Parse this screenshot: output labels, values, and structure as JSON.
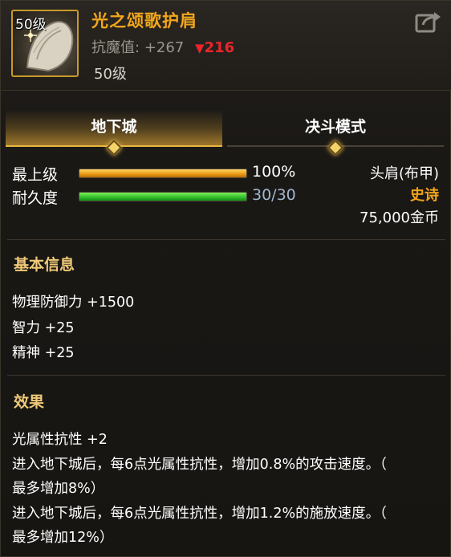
{
  "item": {
    "level_badge": "50级",
    "name": "光之颂歌护肩",
    "resist_label": "抗魔值:",
    "resist_plus": "+267",
    "resist_arrow": "▼",
    "resist_down": "216",
    "required_level": "50级",
    "share_icon": "share-export-icon"
  },
  "tabs": [
    {
      "label": "地下城",
      "active": true
    },
    {
      "label": "决斗模式",
      "active": false
    }
  ],
  "bars": [
    {
      "label": "最上级",
      "value_text": "100%",
      "fraction": 1.0,
      "color": "gold"
    },
    {
      "label": "耐久度",
      "value_text": "30/30",
      "fraction": 1.0,
      "color": "green"
    }
  ],
  "info": {
    "slot": "头肩(布甲)",
    "rarity": "史诗",
    "price": "75,000金币"
  },
  "basic": {
    "title": "基本信息",
    "lines": [
      "物理防御力 +1500",
      "智力 +25",
      "精神 +25"
    ]
  },
  "effect": {
    "title": "效果",
    "lines": [
      "光属性抗性 +2",
      "进入地下城后，每6点光属性抗性，增加0.8%的攻击速度。（",
      "最多增加8%）",
      "进入地下城后，每6点光属性抗性，增加1.2%的施放速度。（",
      "最多增加12%）"
    ]
  },
  "colors": {
    "accent_gold": "#f2a71b",
    "stat_down_red": "#e8262b",
    "durability_blue": "#9fb7cf"
  }
}
